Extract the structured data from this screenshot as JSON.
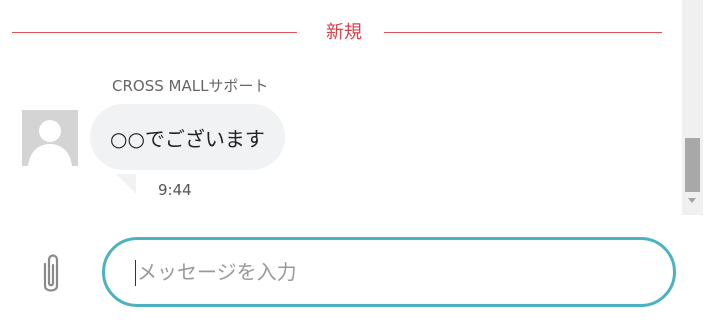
{
  "chat": {
    "divider_label": "新規",
    "sender_name": "CROSS MALLサポート",
    "message_text": "○○でございます",
    "message_time": "9:44"
  },
  "input": {
    "placeholder": "メッセージを入力",
    "value": ""
  },
  "icons": {
    "attach": "paperclip-icon",
    "avatar": "user-avatar-icon",
    "scroll_down": "scroll-down-arrow-icon"
  },
  "colors": {
    "divider": "#e0525a",
    "divider_text": "#d9414b",
    "bubble_bg": "#f1f2f4",
    "input_border": "#4bb3bf",
    "scroll_thumb": "#a8a8a8"
  }
}
